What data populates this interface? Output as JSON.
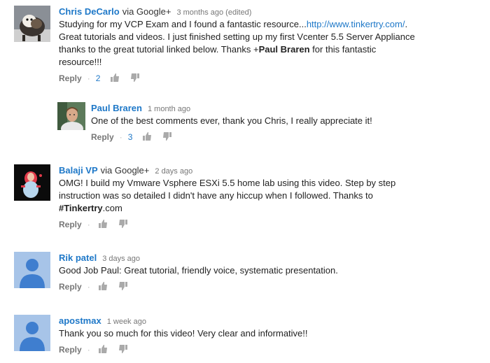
{
  "comments": [
    {
      "author": "Chris DeCarlo",
      "via": "via Google+",
      "time": "3 months ago (edited)",
      "lines": {
        "l1_pre": "Studying for my VCP Exam and I found a fantastic resource...",
        "l1_link": "http://www.tinkertry.com/",
        "l1_post": ".",
        "l2": " Great tutorials and videos.  I just finished setting up my first Vcenter 5.5 Server Appliance",
        "l3_pre": "thanks to the great tutorial linked below.  Thanks +",
        "l3_mention": "Paul Braren",
        "l3_post": " for this fantastic",
        "l4": "resource!!!"
      },
      "reply_label": "Reply",
      "likes": "2",
      "avatar": "photo-dog"
    },
    {
      "author": "Paul Braren",
      "time": "1 month ago",
      "lines": {
        "l1": "One of the best comments ever, thank you Chris, I really appreciate it!"
      },
      "reply_label": "Reply",
      "likes": "3",
      "avatar": "photo-man"
    },
    {
      "author": "Balaji VP",
      "via": "via Google+",
      "time": "2 days ago",
      "lines": {
        "l1": "OMG! I  build my Vmware Vsphere ESXi 5.5 home lab using this video. Step by step",
        "l2": "instruction was so detailed I didn't have any hiccup when I followed. Thanks to",
        "l3_tag": "#Tinkertry",
        "l3_post": ".com"
      },
      "reply_label": "Reply",
      "avatar": "photo-figure"
    },
    {
      "author": "Rik patel",
      "time": "3 days ago",
      "lines": {
        "l1": "Good Job Paul: Great tutorial, friendly voice, systematic presentation."
      },
      "reply_label": "Reply",
      "avatar": "default-person"
    },
    {
      "author": "apostmax",
      "time": "1 week ago",
      "lines": {
        "l1": "Thank you so much for this video! Very clear and informative!!"
      },
      "reply_label": "Reply",
      "avatar": "default-person"
    }
  ],
  "colors": {
    "author": "#1e78c8",
    "link": "#1e78c8",
    "meta": "#777777",
    "avatar_default_bg": "#a7c4e8",
    "avatar_default_fg": "#3f7ecf"
  },
  "icons": {
    "like": "thumbs-up-icon",
    "dislike": "thumbs-down-icon",
    "separator": "·"
  },
  "separator": "·"
}
